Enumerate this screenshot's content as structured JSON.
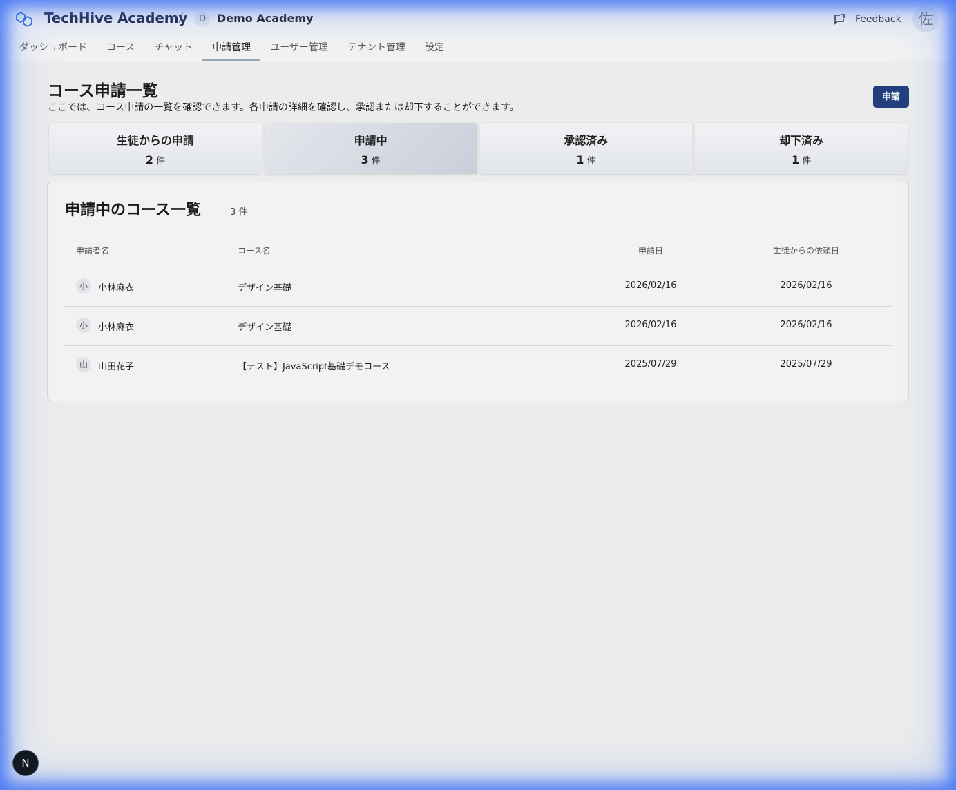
{
  "header": {
    "brand": "TechHive Academy",
    "separator": "/",
    "tenant_initial": "D",
    "tenant_name": "Demo Academy",
    "feedback_label": "Feedback",
    "user_initial": "佐"
  },
  "nav": {
    "tabs": [
      {
        "label": "ダッシュボード"
      },
      {
        "label": "コース"
      },
      {
        "label": "チャット"
      },
      {
        "label": "申請管理"
      },
      {
        "label": "ユーザー管理"
      },
      {
        "label": "テナント管理"
      },
      {
        "label": "設定"
      }
    ],
    "active_index": 3
  },
  "page": {
    "title": "コース申請一覧",
    "description": "ここでは、コース申請の一覧を確認できます。各申請の詳細を確認し、承認または却下することができます。",
    "apply_button": "申請"
  },
  "stats": [
    {
      "label": "生徒からの申請",
      "count": "2",
      "unit": "件"
    },
    {
      "label": "申請中",
      "count": "3",
      "unit": "件"
    },
    {
      "label": "承認済み",
      "count": "1",
      "unit": "件"
    },
    {
      "label": "却下済み",
      "count": "1",
      "unit": "件"
    }
  ],
  "list": {
    "title": "申請中のコース一覧",
    "count": "3 件",
    "columns": {
      "applicant": "申請者名",
      "course": "コース名",
      "applied_date": "申請日",
      "student_request_date": "生徒からの依頼日"
    },
    "rows": [
      {
        "initial": "小",
        "applicant": "小林麻衣",
        "course": "デザイン基礎",
        "applied_date": "2026/02/16",
        "student_request_date": "2026/02/16"
      },
      {
        "initial": "小",
        "applicant": "小林麻衣",
        "course": "デザイン基礎",
        "applied_date": "2026/02/16",
        "student_request_date": "2026/02/16"
      },
      {
        "initial": "山",
        "applicant": "山田花子",
        "course": "【テスト】JavaScript基礎デモコース",
        "applied_date": "2025/07/29",
        "student_request_date": "2025/07/29"
      }
    ]
  },
  "dev_badge": "N",
  "colors": {
    "primary": "#23407e",
    "background": "#ececec",
    "frame_glow": "#3b6ef5"
  }
}
